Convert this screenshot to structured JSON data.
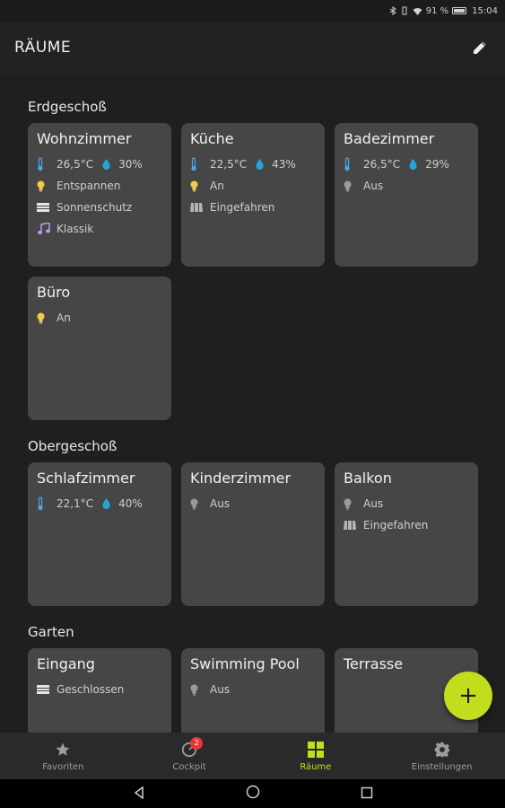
{
  "status_bar": {
    "battery_text": "91 %",
    "time": "15:04"
  },
  "app_bar": {
    "title": "RÄUME"
  },
  "sections": [
    {
      "title": "Erdgeschoß",
      "rooms": [
        {
          "name": "Wohnzimmer",
          "temperature": "26,5°C",
          "humidity": "30%",
          "light": "Entspannen",
          "shade": "Sonnenschutz",
          "music": "Klassik"
        },
        {
          "name": "Küche",
          "temperature": "22,5°C",
          "humidity": "43%",
          "light": "An",
          "shade": "Eingefahren"
        },
        {
          "name": "Badezimmer",
          "temperature": "26,5°C",
          "humidity": "29%",
          "light": "Aus"
        },
        {
          "name": "Büro",
          "light": "An"
        }
      ]
    },
    {
      "title": "Obergeschoß",
      "rooms": [
        {
          "name": "Schlafzimmer",
          "temperature": "22,1°C",
          "humidity": "40%"
        },
        {
          "name": "Kinderzimmer",
          "light": "Aus"
        },
        {
          "name": "Balkon",
          "light": "Aus",
          "shade": "Eingefahren"
        }
      ]
    },
    {
      "title": "Garten",
      "rooms": [
        {
          "name": "Eingang",
          "shade": "Geschlossen"
        },
        {
          "name": "Swimming Pool",
          "light": "Aus"
        },
        {
          "name": "Terrasse"
        }
      ]
    }
  ],
  "fab": {
    "label": "+"
  },
  "bottom_nav": [
    {
      "label": "Favoriten",
      "icon": "star-icon"
    },
    {
      "label": "Cockpit",
      "icon": "gauge-icon",
      "badge": "2"
    },
    {
      "label": "Räume",
      "icon": "grid-icon",
      "active": true
    },
    {
      "label": "Einstellungen",
      "icon": "gear-icon"
    }
  ],
  "colors": {
    "accent": "#c3dd1e",
    "card": "#464646",
    "background": "#1f1f1f",
    "thermo": "#4aa8e8",
    "drop": "#29a3e0",
    "bulb_on": "#f7c948",
    "bulb_off": "#9a9a9a",
    "music": "#c79be8",
    "badge": "#e53935"
  }
}
